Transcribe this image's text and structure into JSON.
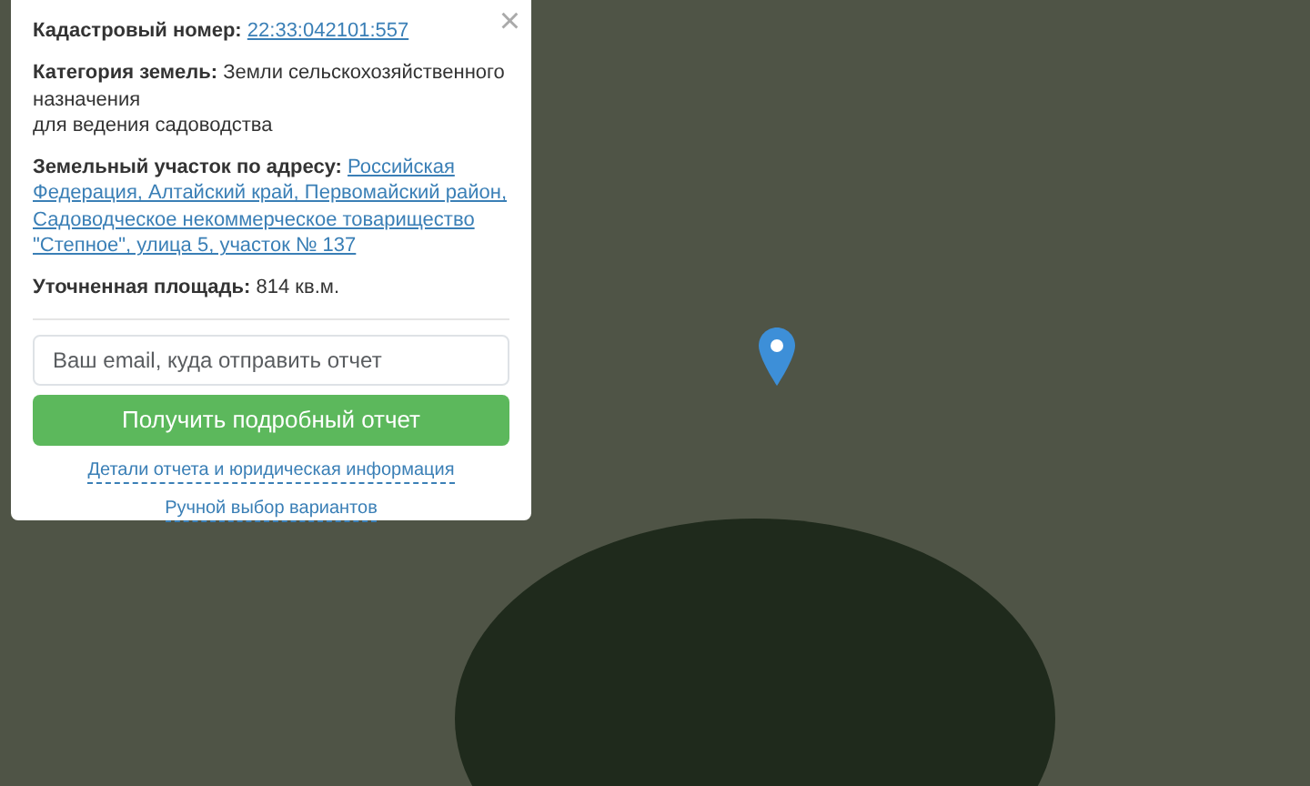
{
  "popup": {
    "close": "×",
    "fields": [
      {
        "label": "Кадастровый номер:",
        "lines": [
          "22:33:042101:557"
        ],
        "kind": "link"
      },
      {
        "label": "Категория земель:",
        "value": "Земли сельскохозяйственного назначения",
        "extra": "для ведения садоводства",
        "kind": "text"
      },
      {
        "label": "Земельный участок по адресу:",
        "lines": [
          "Российская",
          "Федерация, Алтайский край, Первомайский район,",
          "Садоводческое некоммерческое товарищество",
          "\"Степное\", улица 5, участок № 137"
        ],
        "kind": "link"
      },
      {
        "label": "Уточненная площадь:",
        "value": "814 кв.м.",
        "kind": "text"
      }
    ],
    "email": {
      "placeholder": "Ваш email, куда отправить отчет"
    },
    "button": "Получить подробный отчет",
    "links": [
      "Детали отчета и юридическая информация",
      "Ручной выбор вариантов"
    ]
  }
}
